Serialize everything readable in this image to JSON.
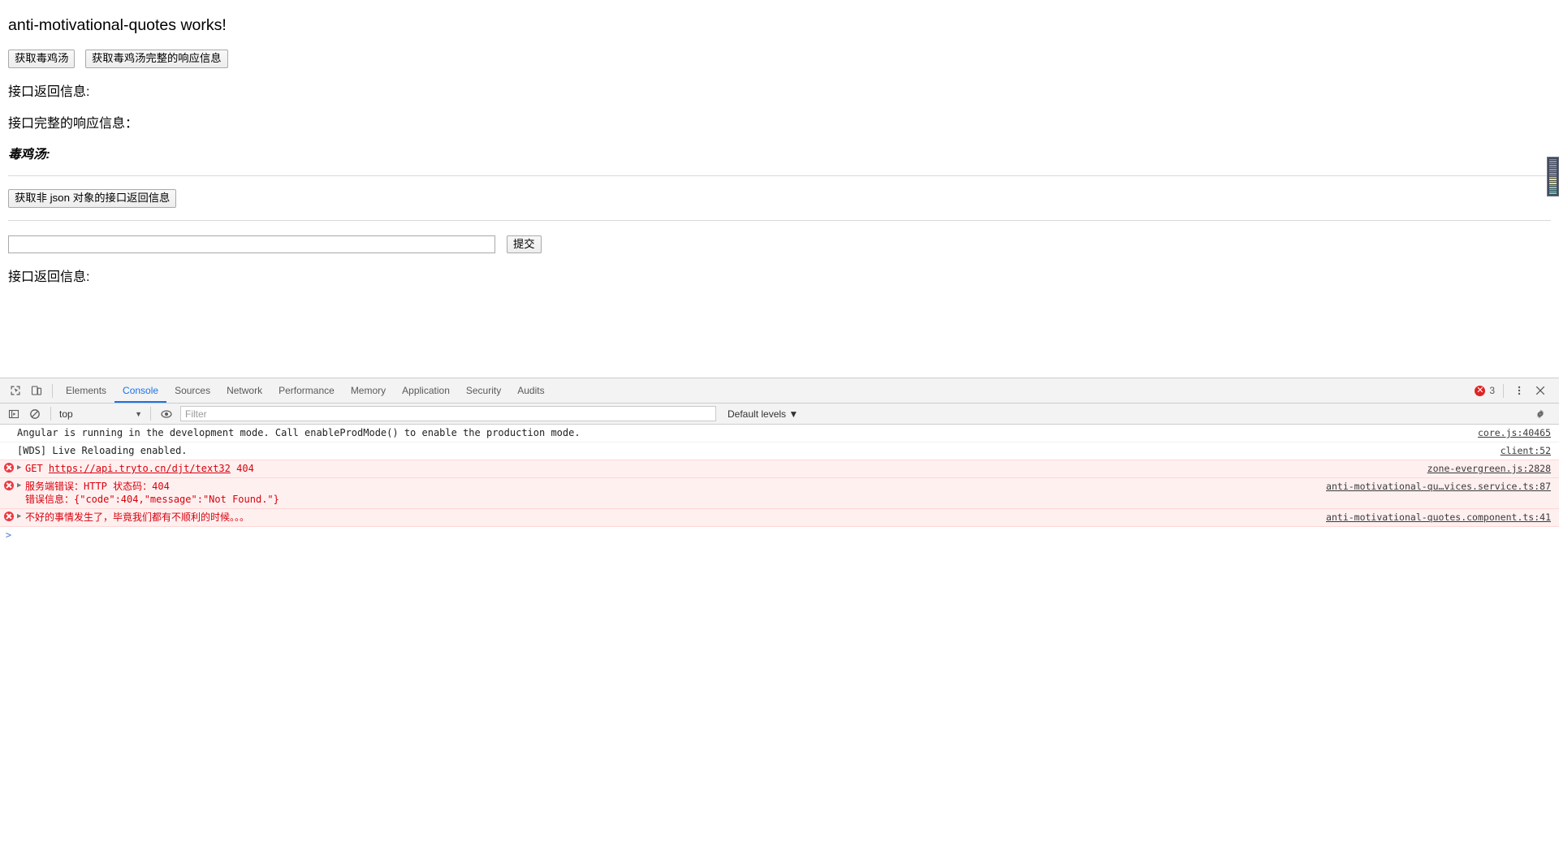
{
  "page": {
    "title": "anti-motivational-quotes works!",
    "buttons": {
      "fetch_quote": "获取毒鸡汤",
      "fetch_full_response": "获取毒鸡汤完整的响应信息",
      "fetch_non_json": "获取非 json 对象的接口返回信息",
      "submit": "提交"
    },
    "labels": {
      "api_result": "接口返回信息:",
      "api_full_response": "接口完整的响应信息：",
      "quote_label": "毒鸡汤:",
      "api_result_2": "接口返回信息:"
    },
    "input": {
      "value": "",
      "placeholder": ""
    }
  },
  "devtools": {
    "tabs": [
      {
        "label": "Elements",
        "active": false
      },
      {
        "label": "Console",
        "active": true
      },
      {
        "label": "Sources",
        "active": false
      },
      {
        "label": "Network",
        "active": false
      },
      {
        "label": "Performance",
        "active": false
      },
      {
        "label": "Memory",
        "active": false
      },
      {
        "label": "Application",
        "active": false
      },
      {
        "label": "Security",
        "active": false
      },
      {
        "label": "Audits",
        "active": false
      }
    ],
    "error_count": "3",
    "icons": {
      "inspect": "inspect-element-icon",
      "device": "device-toolbar-icon",
      "more": "more-options-icon",
      "close": "close-icon",
      "sidebar": "console-sidebar-icon",
      "clear": "clear-console-icon",
      "eye": "live-expression-icon",
      "settings": "settings-gear-icon"
    },
    "filterbar": {
      "context": "top",
      "context_caret": "▼",
      "filter_placeholder": "Filter",
      "filter_value": "",
      "levels": "Default levels ▼"
    },
    "messages": [
      {
        "level": "log",
        "text": "Angular is running in the development mode. Call enableProdMode() to enable the production mode.",
        "source": "core.js:40465",
        "expandable": false
      },
      {
        "level": "log",
        "text": "[WDS] Live Reloading enabled.",
        "source": "client:52",
        "expandable": false
      },
      {
        "level": "error",
        "method": "GET",
        "url": "https://api.tryto.cn/djt/text32",
        "status": "404",
        "source": "zone-evergreen.js:2828",
        "expandable": true
      },
      {
        "level": "error",
        "text": "服务端错误：HTTP 状态码：404\n错误信息：{\"code\":404,\"message\":\"Not Found.\"}",
        "source": "anti-motivational-qu…vices.service.ts:87",
        "expandable": true
      },
      {
        "level": "error",
        "text": "不好的事情发生了，毕竟我们都有不顺利的时候。。。",
        "source": "anti-motivational-quotes.component.ts:41",
        "expandable": true
      }
    ],
    "prompt": ">"
  },
  "minimap": {
    "name": "scrollbar-minimap",
    "bars": [
      "#8b92a6",
      "#8b92a6",
      "#8b92a6",
      "#8b92a6",
      "#8b92a6",
      "#8b92a6",
      "#8b92a6",
      "#8b92a6",
      "#8b92a6",
      "#e8e24a",
      "#e8e24a",
      "#e8e24a",
      "#e8e24a",
      "#5fd1b5",
      "#5fd1b5",
      "#5fd1b5",
      "#5fd1b5",
      "#5fd1b5"
    ]
  },
  "colors": {
    "accent": "#1a73e8",
    "error": "#d8000c",
    "error_bg": "#fff0f0",
    "toolbar_bg": "#f3f3f3"
  }
}
